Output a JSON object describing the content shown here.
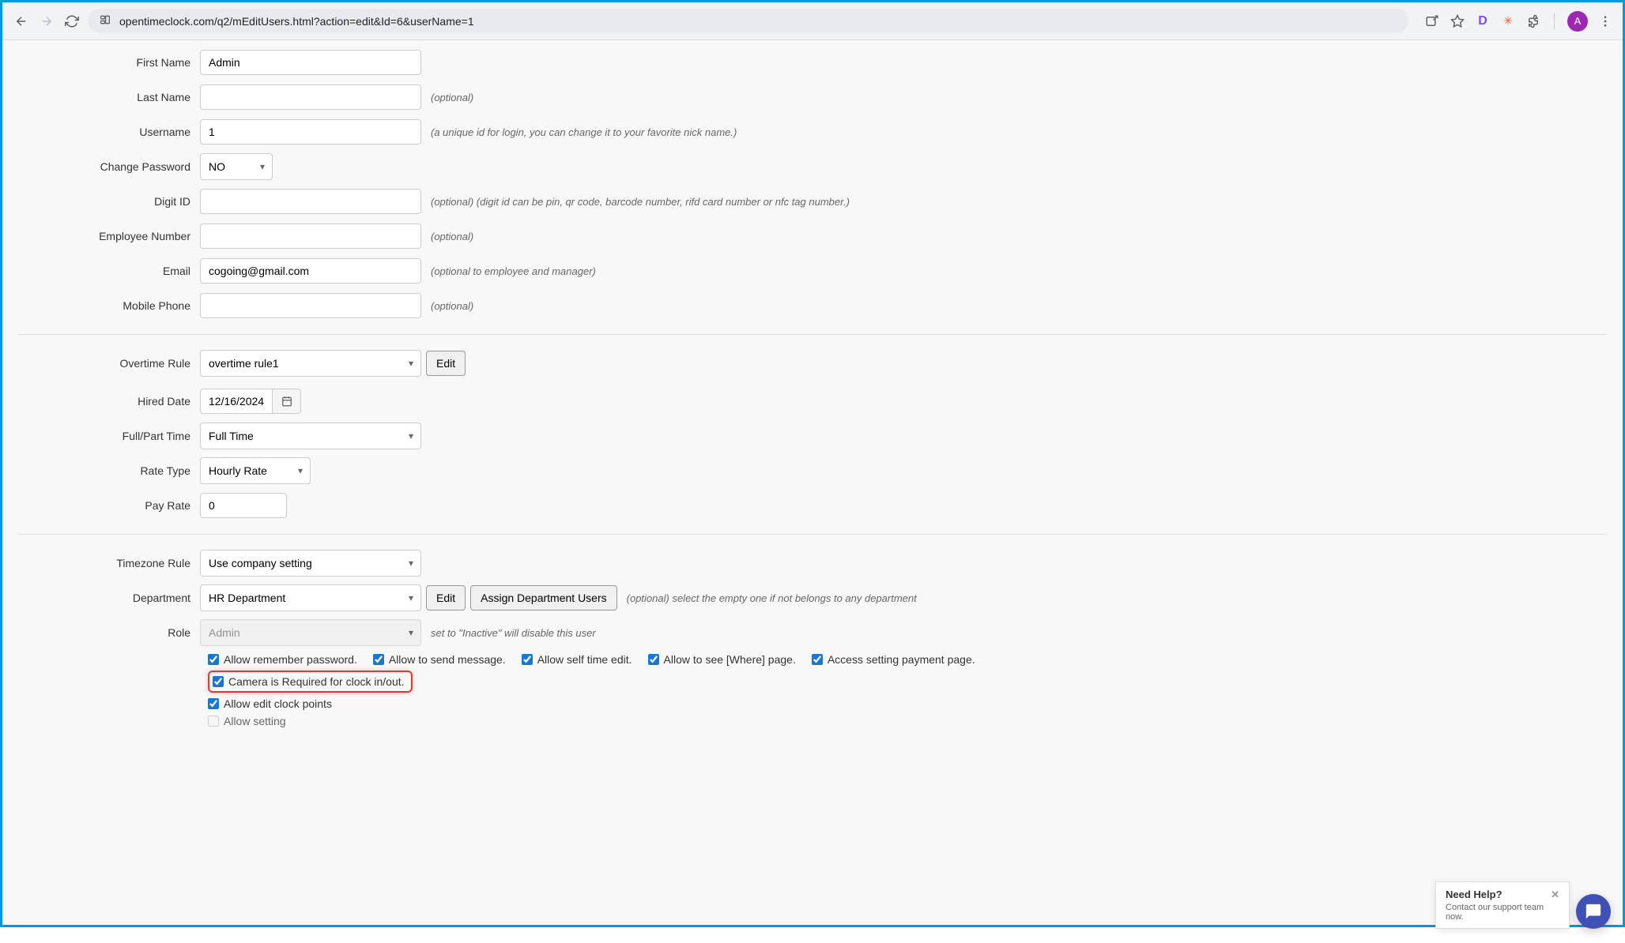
{
  "browser": {
    "url": "opentimeclock.com/q2/mEditUsers.html?action=edit&Id=6&userName=1",
    "avatar_letter": "A"
  },
  "form": {
    "first_name": {
      "label": "First Name",
      "value": "Admin"
    },
    "last_name": {
      "label": "Last Name",
      "hint": "(optional)"
    },
    "username": {
      "label": "Username",
      "value": "1",
      "hint": "(a unique id for login, you can change it to your favorite nick name.)"
    },
    "change_password": {
      "label": "Change Password",
      "value": "NO"
    },
    "digit_id": {
      "label": "Digit ID",
      "hint": "(optional) (digit id can be pin, qr code, barcode number, rifd card number or nfc tag number.)"
    },
    "employee_number": {
      "label": "Employee Number",
      "hint": "(optional)"
    },
    "email": {
      "label": "Email",
      "value": "cogoing@gmail.com",
      "hint": "(optional to employee and manager)"
    },
    "mobile_phone": {
      "label": "Mobile Phone",
      "hint": "(optional)"
    },
    "overtime_rule": {
      "label": "Overtime Rule",
      "value": "overtime rule1",
      "edit": "Edit"
    },
    "hired_date": {
      "label": "Hired Date",
      "value": "12/16/2024"
    },
    "full_part": {
      "label": "Full/Part Time",
      "value": "Full Time"
    },
    "rate_type": {
      "label": "Rate Type",
      "value": "Hourly Rate"
    },
    "pay_rate": {
      "label": "Pay Rate",
      "value": "0"
    },
    "timezone": {
      "label": "Timezone Rule",
      "value": "Use company setting"
    },
    "department": {
      "label": "Department",
      "value": "HR Department",
      "edit": "Edit",
      "assign": "Assign Department Users",
      "hint": "(optional) select the empty one if not belongs to any department"
    },
    "role": {
      "label": "Role",
      "value": "Admin",
      "hint": "set to \"Inactive\" will disable this user"
    }
  },
  "checkboxes": {
    "remember_password": "Allow remember password.",
    "send_message": "Allow to send message.",
    "self_time_edit": "Allow self time edit.",
    "where_page": "Allow to see [Where] page.",
    "payment_page": "Access setting payment page.",
    "camera_required": "Camera is Required for clock in/out.",
    "edit_clock_points": "Allow edit clock points",
    "allow_setting": "Allow setting"
  },
  "help": {
    "title": "Need Help?",
    "subtitle": "Contact our support team now."
  }
}
